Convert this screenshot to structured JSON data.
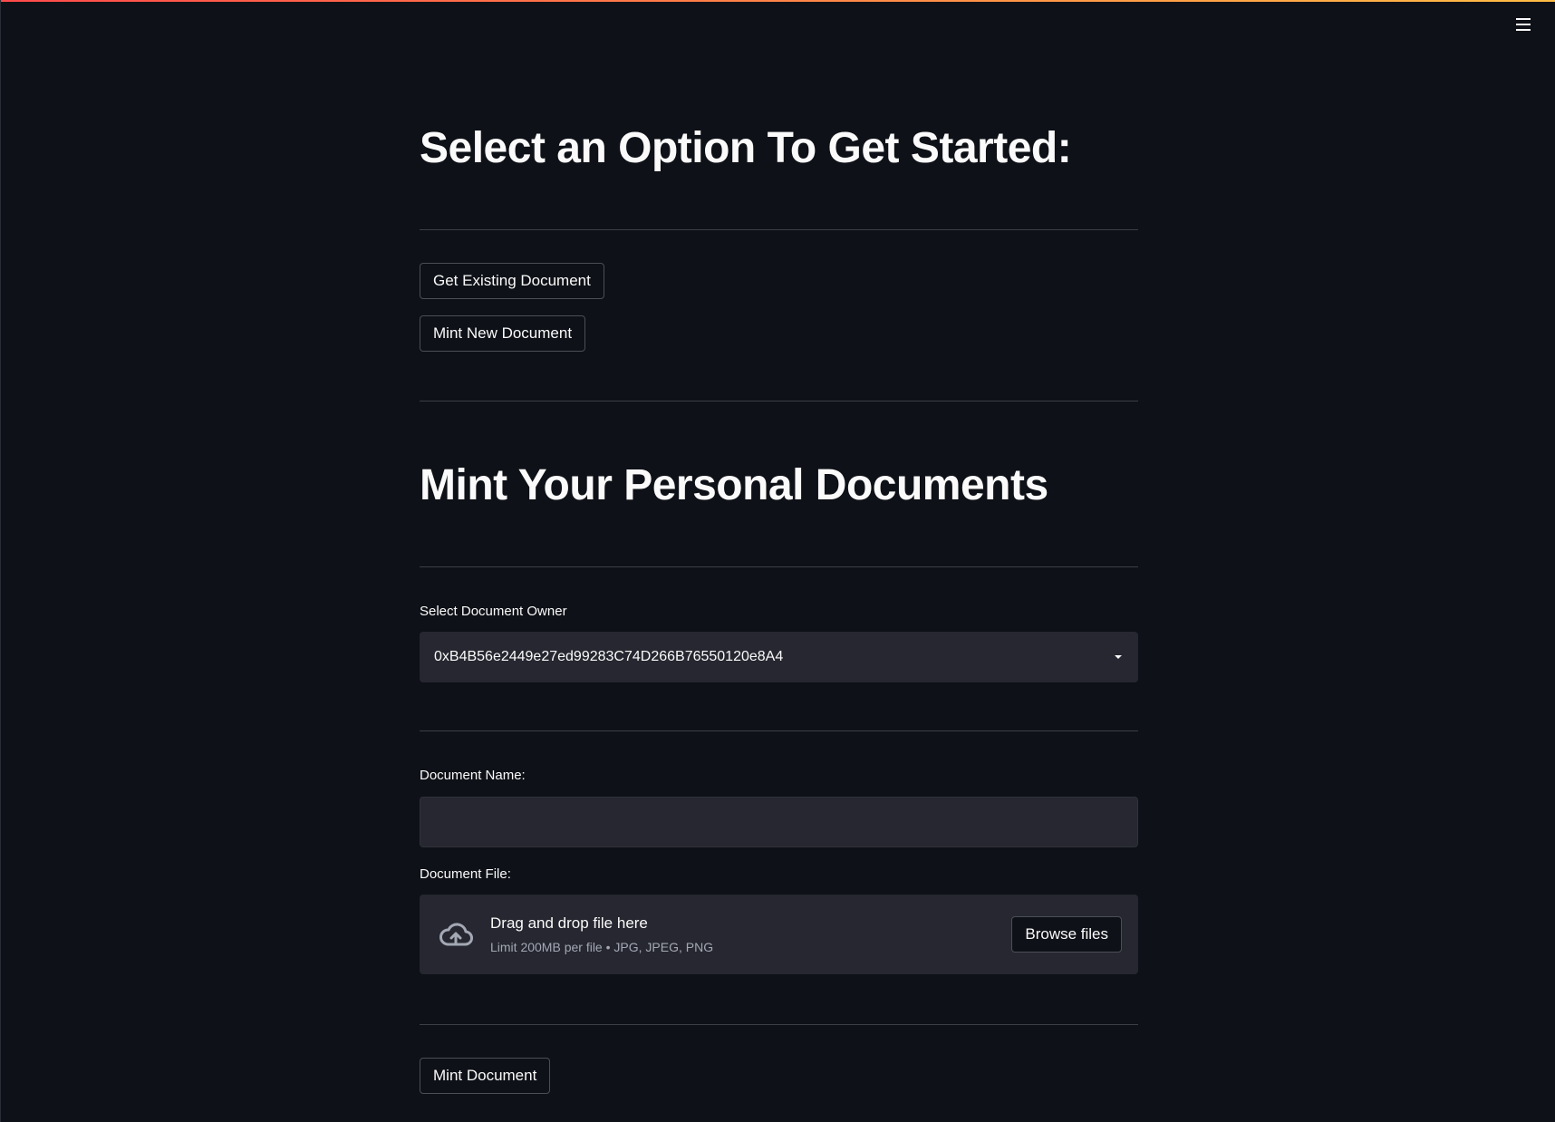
{
  "header": {
    "menu_icon": "hamburger-menu-icon"
  },
  "section1": {
    "title": "Select an Option To Get Started:",
    "buttons": {
      "get_existing": "Get Existing Document",
      "mint_new": "Mint New Document"
    }
  },
  "section2": {
    "title": "Mint Your Personal Documents",
    "owner": {
      "label": "Select Document Owner",
      "selected": "0xB4B56e2449e27ed99283C74D266B76550120e8A4",
      "icon": "caret-down-icon"
    },
    "name": {
      "label": "Document Name:",
      "value": ""
    },
    "file": {
      "label": "Document File:",
      "drop_title": "Drag and drop file here",
      "drop_sub": "Limit 200MB per file • JPG, JPEG, PNG",
      "browse_label": "Browse files",
      "icon": "cloud-upload-icon"
    },
    "submit_label": "Mint Document"
  },
  "colors": {
    "background": "#0e1117",
    "input_bg": "#262730",
    "accent_top": "#ff4b4b"
  }
}
